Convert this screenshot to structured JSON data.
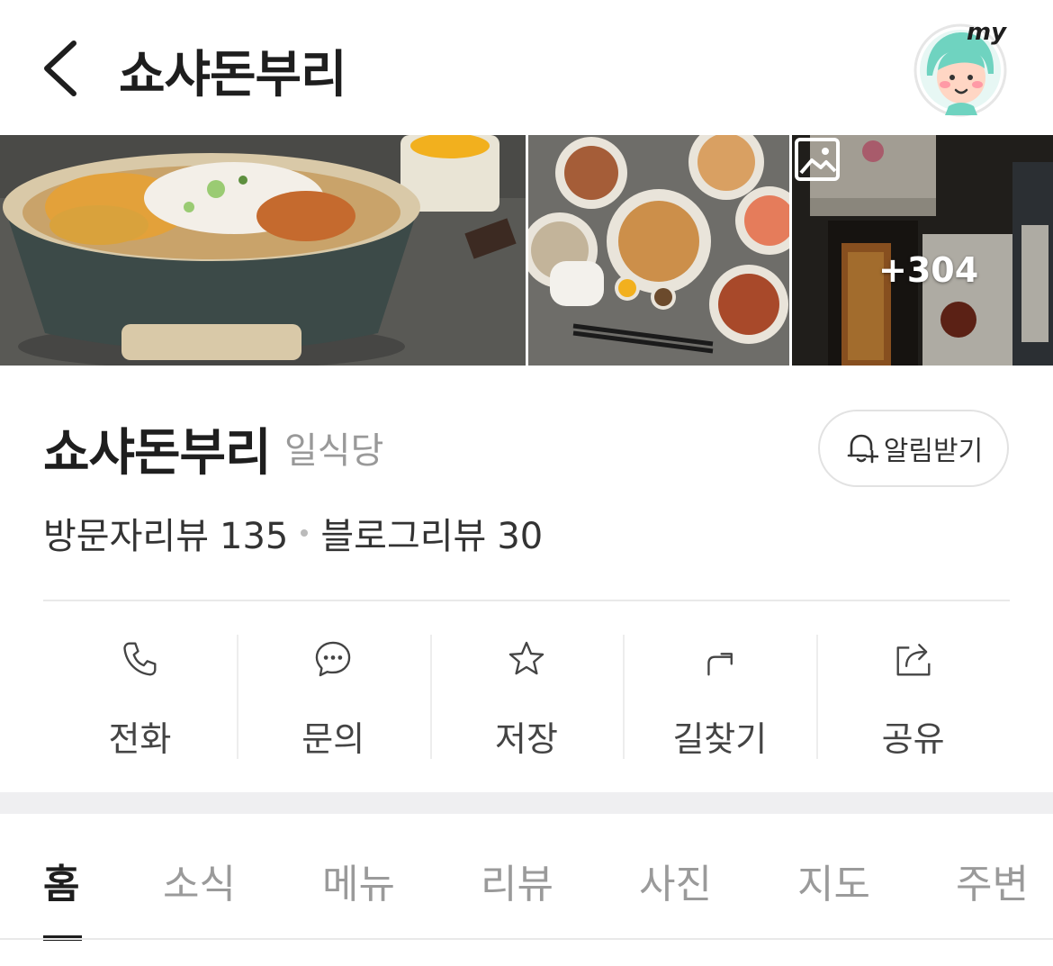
{
  "header": {
    "title": "쇼샤돈부리",
    "avatar_text": "my"
  },
  "photos": {
    "more_count": "+304"
  },
  "place": {
    "name": "쇼샤돈부리",
    "category": "일식당",
    "notify_label": "알림받기",
    "visitor_review_label": "방문자리뷰",
    "visitor_review_count": "135",
    "blog_review_label": "블로그리뷰",
    "blog_review_count": "30"
  },
  "actions": [
    {
      "label": "전화",
      "icon": "phone-icon"
    },
    {
      "label": "문의",
      "icon": "chat-icon"
    },
    {
      "label": "저장",
      "icon": "star-icon"
    },
    {
      "label": "길찾기",
      "icon": "directions-icon"
    },
    {
      "label": "공유",
      "icon": "share-icon"
    }
  ],
  "tabs": [
    {
      "label": "홈",
      "active": true
    },
    {
      "label": "소식"
    },
    {
      "label": "메뉴"
    },
    {
      "label": "리뷰"
    },
    {
      "label": "사진"
    },
    {
      "label": "지도"
    },
    {
      "label": "주변"
    }
  ],
  "colors": {
    "avatar_hair": "#6fd3c0",
    "avatar_face": "#ffd6c4"
  }
}
